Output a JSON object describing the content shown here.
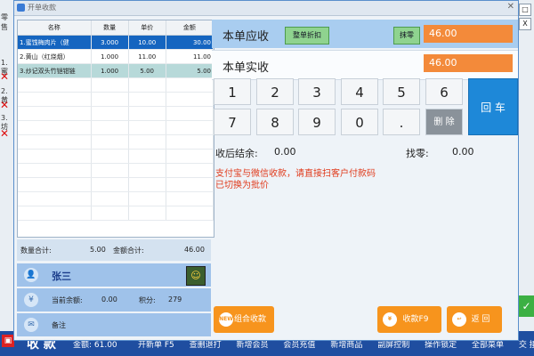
{
  "dialog": {
    "title": "开单收款",
    "close": "✕"
  },
  "background": {
    "left_snippets": [
      "零售",
      "1. 蜜",
      "2. 黄",
      "3. 坊"
    ],
    "right_close": "X",
    "right_restore": "□"
  },
  "grid": {
    "columns": [
      "名称",
      "数量",
      "单价",
      "金额"
    ],
    "rows": [
      {
        "name": "1.蜜饯梅肉片（健",
        "qty": "3.000",
        "price": "10.00",
        "amount": "30.00"
      },
      {
        "name": "2.黄山（红烧烟）",
        "qty": "1.000",
        "price": "11.00",
        "amount": "11.00"
      },
      {
        "name": "3.炒记双头竹铠钳链",
        "qty": "1.000",
        "price": "5.00",
        "amount": "5.00"
      }
    ]
  },
  "summary": {
    "qty_label": "数量合计:",
    "qty_value": "5.00",
    "amount_label": "金额合计:",
    "amount_value": "46.00"
  },
  "member": {
    "name": "张三",
    "balance_label": "当前余额:",
    "balance_value": "0.00",
    "points_label": "积分:",
    "points_value": "279",
    "note_label": "备注"
  },
  "payment": {
    "due_label": "本单应收",
    "discount_button": "整单折扣",
    "rounding_button": "抹零",
    "due_value": "46.00",
    "paid_label": "本单实收",
    "paid_value": "46.00"
  },
  "keypad": {
    "row1": [
      "1",
      "2",
      "3",
      "4",
      "5",
      "6"
    ],
    "row2": [
      "7",
      "8",
      "9",
      "0",
      "."
    ],
    "delete": "删 除",
    "enter": "回 车"
  },
  "status": {
    "balance_after_label": "收后结余:",
    "balance_after_value": "0.00",
    "change_label": "找零:",
    "change_value": "0.00"
  },
  "messages": [
    "支付宝与微信收款，请直接扫客户付款码",
    "已切换为批价"
  ],
  "actions": {
    "combo": "组合收款",
    "combo_badge": "NEW",
    "collect": "收款F9",
    "back": "返  回"
  },
  "bottom_bar": {
    "big_text": "收 款",
    "amount_text": "金额:  61.00",
    "menus": [
      "开新单 F5",
      "查删退打",
      "新增会员",
      "会员充值",
      "新增商品",
      "副屏控制",
      "操作锁定",
      "全部菜单",
      "交 接 班"
    ]
  },
  "colors": {
    "accent_blue": "#1565c0",
    "orange": "#f7941d",
    "enter_blue": "#1e88d8",
    "msg_red": "#e03a1b"
  }
}
